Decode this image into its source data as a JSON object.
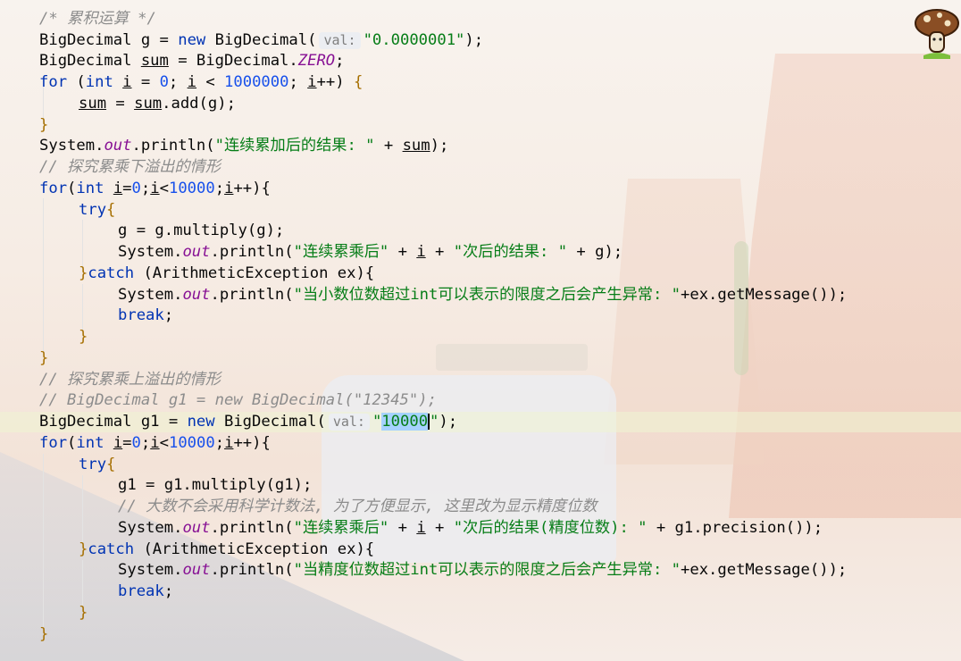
{
  "colors": {
    "keyword": "#0033b3",
    "number": "#1750eb",
    "string": "#067d17",
    "field": "#871094",
    "comment": "#8c8c8c",
    "brace": "#a66f00"
  },
  "code": {
    "c1": "/* 累积运算 */",
    "l2a": "BigDecimal g = ",
    "l2kw": "new",
    "l2b": " BigDecimal(",
    "l2hint": "val:",
    "l2str": "\"0.0000001\"",
    "l2c": ");",
    "l3a": "BigDecimal ",
    "l3var": "sum",
    "l3b": " = BigDecimal.",
    "l3fld": "ZERO",
    "l3c": ";",
    "l4kw": "for",
    "l4a": " (",
    "l4kw2": "int",
    "l4b": " ",
    "l4var": "i",
    "l4c": " = ",
    "l4n0": "0",
    "l4d": "; ",
    "l4var2": "i",
    "l4e": " < ",
    "l4n1": "1000000",
    "l4f": "; ",
    "l4var3": "i",
    "l4g": "++) ",
    "l4br": "{",
    "l5var": "sum",
    "l5a": " = ",
    "l5var2": "sum",
    "l5b": ".add(g);",
    "l6br": "}",
    "l7a": "System.",
    "l7fld": "out",
    "l7b": ".println(",
    "l7str": "\"连续累加后的结果: \"",
    "l7c": " + ",
    "l7var": "sum",
    "l7d": ");",
    "c8": "// 探究累乘下溢出的情形",
    "l9kw": "for",
    "l9a": "(",
    "l9kw2": "int",
    "l9b": " ",
    "l9var": "i",
    "l9c": "=",
    "l9n0": "0",
    "l9d": ";",
    "l9var2": "i",
    "l9e": "<",
    "l9n1": "10000",
    "l9f": ";",
    "l9var3": "i",
    "l9g": "++){",
    "l10kw": "try",
    "l10br": "{",
    "l11": "g = g.multiply(g);",
    "l12a": "System.",
    "l12fld": "out",
    "l12b": ".println(",
    "l12str": "\"连续累乘后\"",
    "l12c": " + ",
    "l12var": "i",
    "l12d": " + ",
    "l12str2": "\"次后的结果: \"",
    "l12e": " + g);",
    "l13br": "}",
    "l13kw": "catch",
    "l13a": " (ArithmeticException ex){",
    "l14a": "System.",
    "l14fld": "out",
    "l14b": ".println(",
    "l14str": "\"当小数位数超过int可以表示的限度之后会产生异常: \"",
    "l14c": "+ex.getMessage());",
    "l15kw": "break",
    "l15a": ";",
    "l16br": "}",
    "l17br": "}",
    "c18": "// 探究累乘上溢出的情形",
    "c19": "// BigDecimal g1 = new BigDecimal(\"12345\");",
    "l20a": "BigDecimal g1 = ",
    "l20kw": "new",
    "l20b": " BigDecimal(",
    "l20hint": "val:",
    "l20q": "\"",
    "l20sel": "10000",
    "l20q2": "\"",
    "l20c": ");",
    "l21kw": "for",
    "l21a": "(",
    "l21kw2": "int",
    "l21b": " ",
    "l21var": "i",
    "l21c": "=",
    "l21n0": "0",
    "l21d": ";",
    "l21var2": "i",
    "l21e": "<",
    "l21n1": "10000",
    "l21f": ";",
    "l21var3": "i",
    "l21g": "++){",
    "l22kw": "try",
    "l22br": "{",
    "l23": "g1 = g1.multiply(g1);",
    "c24": "// 大数不会采用科学计数法, 为了方便显示, 这里改为显示精度位数",
    "l25a": "System.",
    "l25fld": "out",
    "l25b": ".println(",
    "l25str": "\"连续累乘后\"",
    "l25c": " + ",
    "l25var": "i",
    "l25d": " + ",
    "l25str2": "\"次后的结果(精度位数): \"",
    "l25e": " + g1.precision());",
    "l26br": "}",
    "l26kw": "catch",
    "l26a": " (ArithmeticException ex){",
    "l27a": "System.",
    "l27fld": "out",
    "l27b": ".println(",
    "l27str": "\"当精度位数超过int可以表示的限度之后会产生异常: \"",
    "l27c": "+ex.getMessage());",
    "l28kw": "break",
    "l28a": ";",
    "l29br": "}",
    "l30br": "}"
  },
  "icons": {
    "mascot": "mushroom-mascot-icon"
  }
}
